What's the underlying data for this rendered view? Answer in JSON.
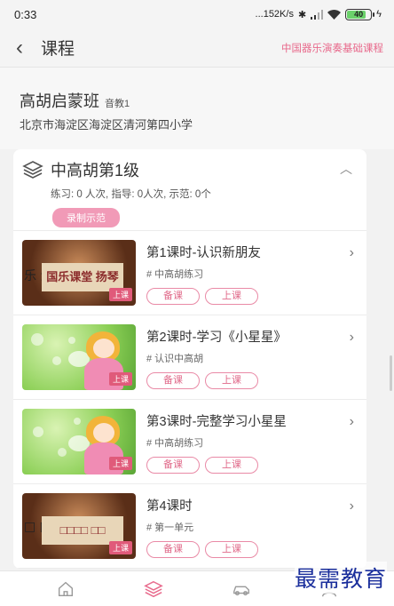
{
  "status_bar": {
    "time": "0:33",
    "network_speed": "...152K/s",
    "battery_level": "40"
  },
  "nav": {
    "title": "课程",
    "right_link": "中国器乐演奏基础课程"
  },
  "class_info": {
    "name": "高胡启蒙班",
    "teacher": "音教1",
    "school": "北京市海淀区海淀区清河第四小学"
  },
  "level": {
    "title": "中高胡第1级",
    "stats": "练习: 0 人次, 指导: 0人次, 示范: 0个",
    "record_button": "录制示范"
  },
  "lessons": [
    {
      "title": "第1课时-认识新朋友",
      "tag": "# 中高胡练习",
      "badge": "上课",
      "thumb_text": "国乐课堂 扬琴",
      "thumb_side": "乐 海",
      "prepare": "备课",
      "start": "上课"
    },
    {
      "title": "第2课时-学习《小星星》",
      "tag": "# 认识中高胡",
      "badge": "上课",
      "prepare": "备课",
      "start": "上课"
    },
    {
      "title": "第3课时-完整学习小星星",
      "tag": "# 中高胡练习",
      "badge": "上课",
      "prepare": "备课",
      "start": "上课"
    },
    {
      "title": "第4课时",
      "tag": "# 第一单元",
      "badge": "上课",
      "thumb_text": "□□□□ □□",
      "thumb_side": "□ □",
      "prepare": "备课",
      "start": "上课"
    }
  ],
  "tabs": [
    "home-icon",
    "layers-icon",
    "car-icon",
    "user-icon"
  ],
  "watermark": "最需教育",
  "colors": {
    "accent": "#e86a8c",
    "pill_border": "#e98aa6",
    "record_bg": "#f19ab7"
  }
}
